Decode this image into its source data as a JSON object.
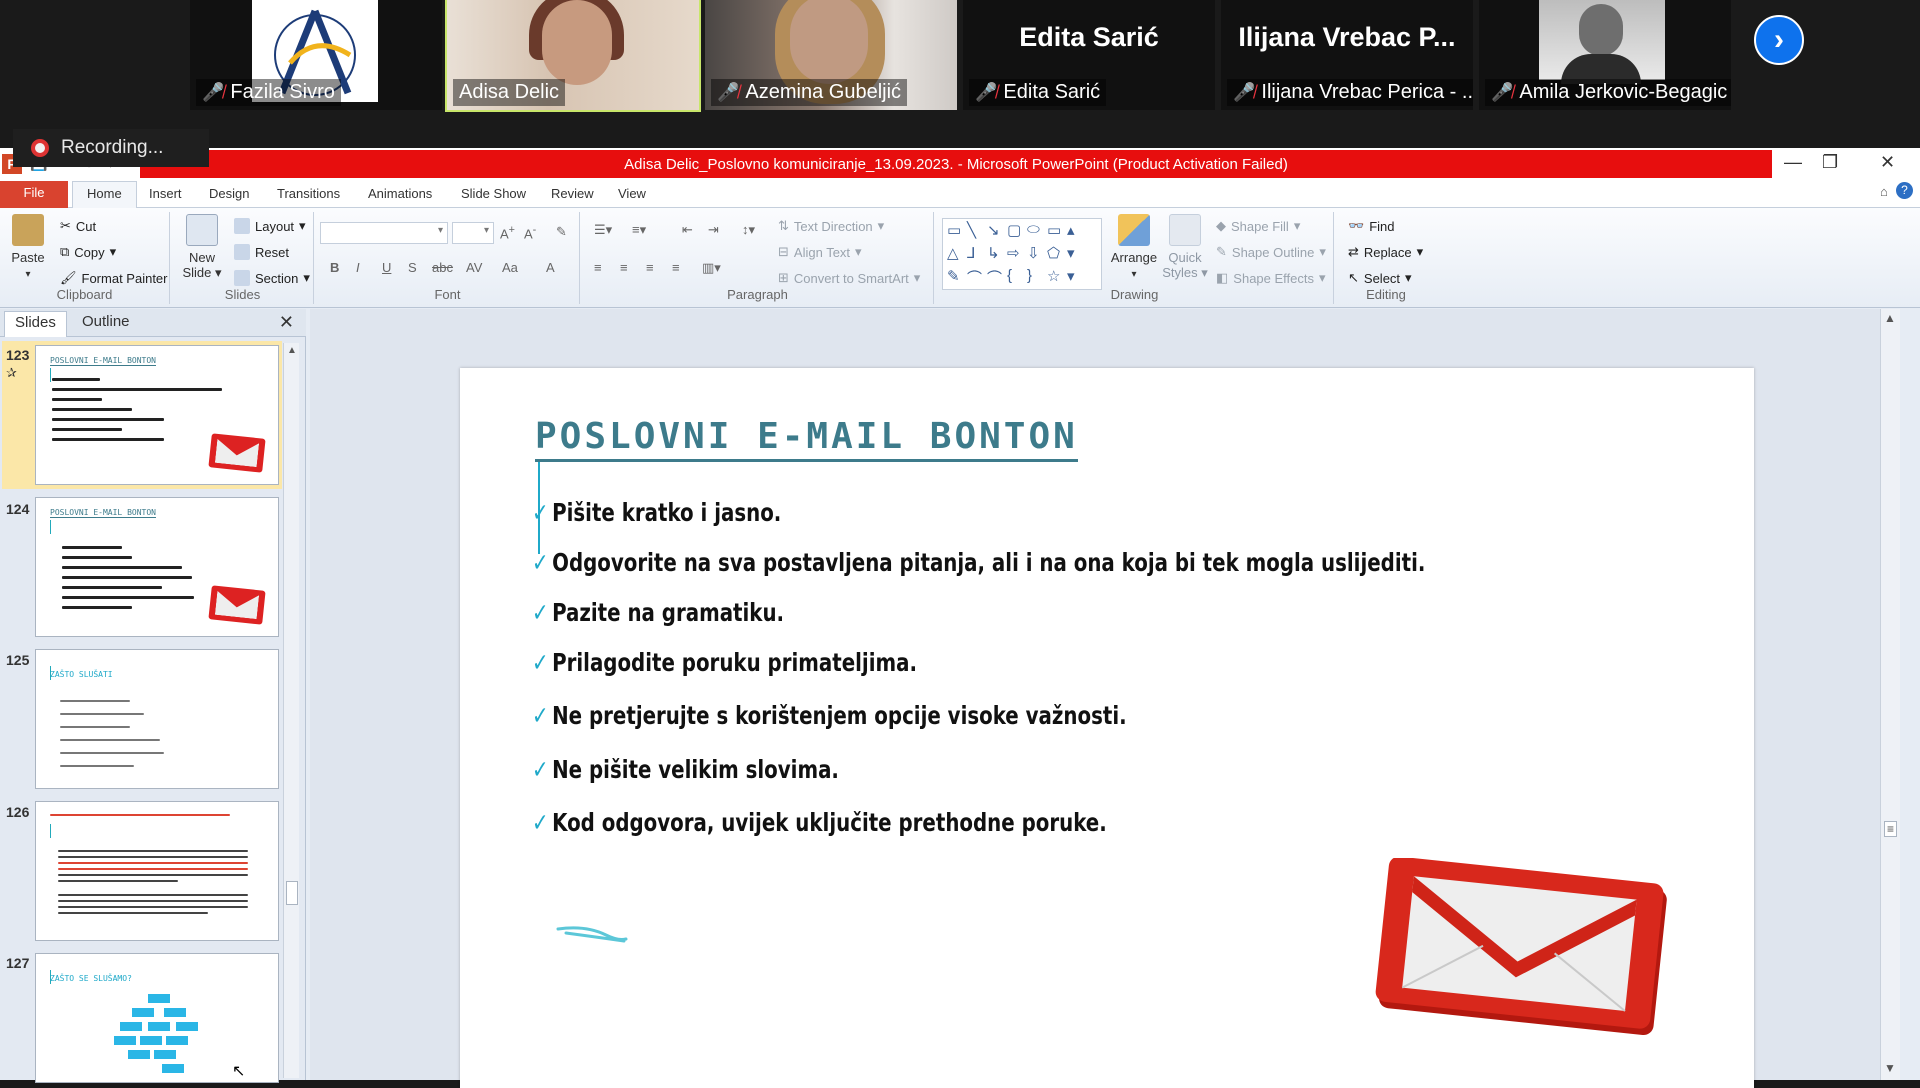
{
  "zoom": {
    "participants": [
      {
        "name": "Fazila Sivro",
        "muted": true
      },
      {
        "name": "Adisa Delic",
        "muted": false,
        "active": true
      },
      {
        "name": "Azemina Gubeljić",
        "muted": true
      },
      {
        "name": "Edita Sarić",
        "muted": true,
        "display": "Edita Sarić"
      },
      {
        "name": "Ilijana Vrebac Perica - ...",
        "muted": true,
        "display": "Ilijana Vrebac P..."
      },
      {
        "name": "Amila Jerkovic-Begagic",
        "muted": true
      }
    ],
    "recording_label": "Recording...",
    "next_icon": "chevron-right-icon"
  },
  "ppt": {
    "window_title": "Adisa Delic_Poslovno komuniciranje_13.09.2023. - Microsoft PowerPoint (Product Activation Failed)",
    "tabs": [
      "File",
      "Home",
      "Insert",
      "Design",
      "Transitions",
      "Animations",
      "Slide Show",
      "Review",
      "View"
    ],
    "ribbon": {
      "clipboard": {
        "label": "Clipboard",
        "paste": "Paste",
        "cut": "Cut",
        "copy": "Copy",
        "format_painter": "Format Painter"
      },
      "slides": {
        "label": "Slides",
        "new_slide": "New Slide",
        "layout": "Layout",
        "reset": "Reset",
        "section": "Section"
      },
      "font": {
        "label": "Font"
      },
      "paragraph": {
        "label": "Paragraph",
        "text_direction": "Text Direction",
        "align_text": "Align Text",
        "convert_smartart": "Convert to SmartArt"
      },
      "drawing": {
        "label": "Drawing",
        "arrange": "Arrange",
        "quick_styles": "Quick Styles",
        "shape_fill": "Shape Fill",
        "shape_outline": "Shape Outline",
        "shape_effects": "Shape Effects"
      },
      "editing": {
        "label": "Editing",
        "find": "Find",
        "replace": "Replace",
        "select": "Select"
      }
    },
    "panel": {
      "tab_slides": "Slides",
      "tab_outline": "Outline"
    },
    "thumbnails": [
      {
        "num": "123",
        "title": "POSLOVNI E-MAIL BONTON",
        "selected": true
      },
      {
        "num": "124",
        "title": "POSLOVNI E-MAIL BONTON",
        "selected": false
      },
      {
        "num": "125",
        "title": "ZAŠTO SLUŠATI",
        "selected": false
      },
      {
        "num": "126",
        "title": "",
        "selected": false
      },
      {
        "num": "127",
        "title": "ZAŠTO SE SLUŠAMO?",
        "selected": false
      }
    ],
    "slide": {
      "title": "POSLOVNI E-MAIL BONTON",
      "bullets": [
        "Pišite kratko i jasno.",
        "Odgovorite na sva postavljena pitanja, ali i na ona koja bi tek mogla uslijediti.",
        "Pazite na gramatiku.",
        "Prilagodite poruku primateljima.",
        "Ne pretjerujte s korištenjem opcije visoke važnosti.",
        "Ne pišite velikim slovima.",
        "Kod odgovora, uvijek uključite prethodne poruke."
      ]
    },
    "colors": {
      "title_teal": "#3d7b8b",
      "check_cyan": "#1fa9c9",
      "titlebar_red": "#e70e0e",
      "gmail_red": "#d22a1e"
    }
  }
}
